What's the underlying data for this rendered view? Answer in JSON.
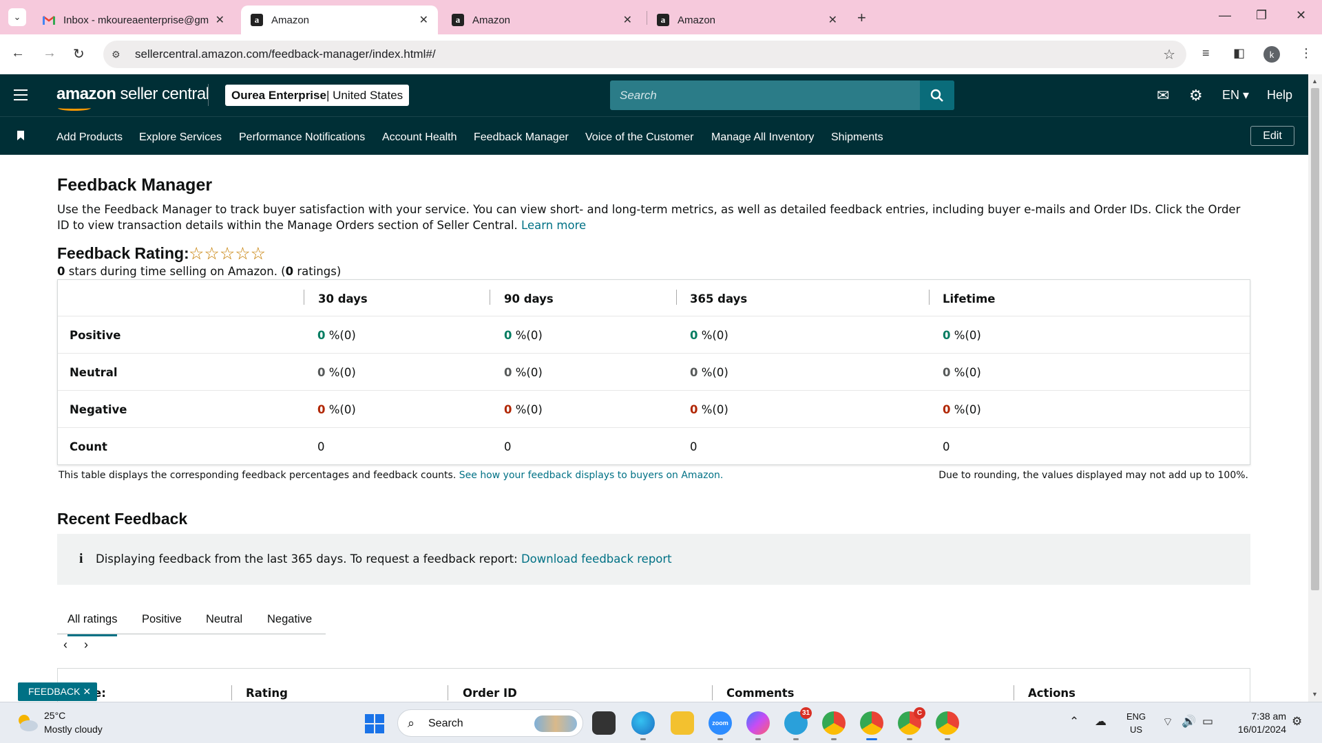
{
  "browser": {
    "tabs": [
      {
        "title": "Inbox - mkoureaenterprise@gm",
        "icon": "gmail-icon",
        "active": false
      },
      {
        "title": "Amazon",
        "icon": "amazon-icon",
        "active": true
      },
      {
        "title": "Amazon",
        "icon": "amazon-icon",
        "active": false
      },
      {
        "title": "Amazon",
        "icon": "amazon-icon",
        "active": false
      }
    ],
    "url": "sellercentral.amazon.com/feedback-manager/index.html#/",
    "profile_initial": "k"
  },
  "header": {
    "logo_bold": "amazon",
    "logo_rest": " seller central",
    "store_name": "Ourea Enterprise",
    "store_region": " | United States",
    "search_placeholder": "Search",
    "language": "EN",
    "help": "Help"
  },
  "nav": {
    "items": [
      "Add Products",
      "Explore Services",
      "Performance Notifications",
      "Account Health",
      "Feedback Manager",
      "Voice of the Customer",
      "Manage All Inventory",
      "Shipments"
    ],
    "edit": "Edit"
  },
  "page": {
    "title": "Feedback Manager",
    "intro": "Use the Feedback Manager to track buyer satisfaction with your service. You can view short- and long-term metrics, as well as detailed feedback entries, including buyer e-mails and Order IDs. Click the Order ID to view transaction details within the Manage Orders section of Seller Central.",
    "learn_more": "Learn more",
    "rating_title": "Feedback Rating:",
    "stars": "☆☆☆☆☆",
    "rating_stars_value": "0",
    "rating_sub_mid": " stars during time selling on Amazon. (",
    "rating_count": "0",
    "rating_sub_end": " ratings)"
  },
  "feedback_table": {
    "columns": [
      "30 days",
      "90 days",
      "365 days",
      "Lifetime"
    ],
    "rows": {
      "positive": {
        "label": "Positive",
        "values": [
          "0",
          "0",
          "0",
          "0"
        ],
        "counts": [
          " %(0)",
          " %(0)",
          " %(0)",
          " %(0)"
        ]
      },
      "neutral": {
        "label": "Neutral",
        "values": [
          "0",
          "0",
          "0",
          "0"
        ],
        "counts": [
          " %(0)",
          " %(0)",
          " %(0)",
          " %(0)"
        ]
      },
      "negative": {
        "label": "Negative",
        "values": [
          "0",
          "0",
          "0",
          "0"
        ],
        "counts": [
          " %(0)",
          " %(0)",
          " %(0)",
          " %(0)"
        ]
      },
      "count": {
        "label": "Count",
        "values": [
          "0",
          "0",
          "0",
          "0"
        ]
      }
    },
    "note": "This table displays the corresponding feedback percentages and feedback counts.",
    "note_link": "See how your feedback displays to buyers on Amazon.",
    "note_right": "Due to rounding, the values displayed may not add up to 100%."
  },
  "recent": {
    "title": "Recent Feedback",
    "info": "Displaying feedback from the last 365 days. To request a feedback report:",
    "info_link": "Download feedback report",
    "tabs": [
      "All ratings",
      "Positive",
      "Neutral",
      "Negative"
    ],
    "list_columns": [
      "Date",
      "Rating",
      "Order ID",
      "Comments",
      "Actions"
    ],
    "list_first_col_visible": "e:",
    "feedback_pill": "FEEDBACK ✕"
  },
  "taskbar": {
    "temperature": "25°C",
    "weather": "Mostly cloudy",
    "search": "Search",
    "telegram_badge": "31",
    "chrome_badge": "C",
    "lang_top": "ENG",
    "lang_bottom": "US",
    "time": "7:38 am",
    "date": "16/01/2024"
  }
}
